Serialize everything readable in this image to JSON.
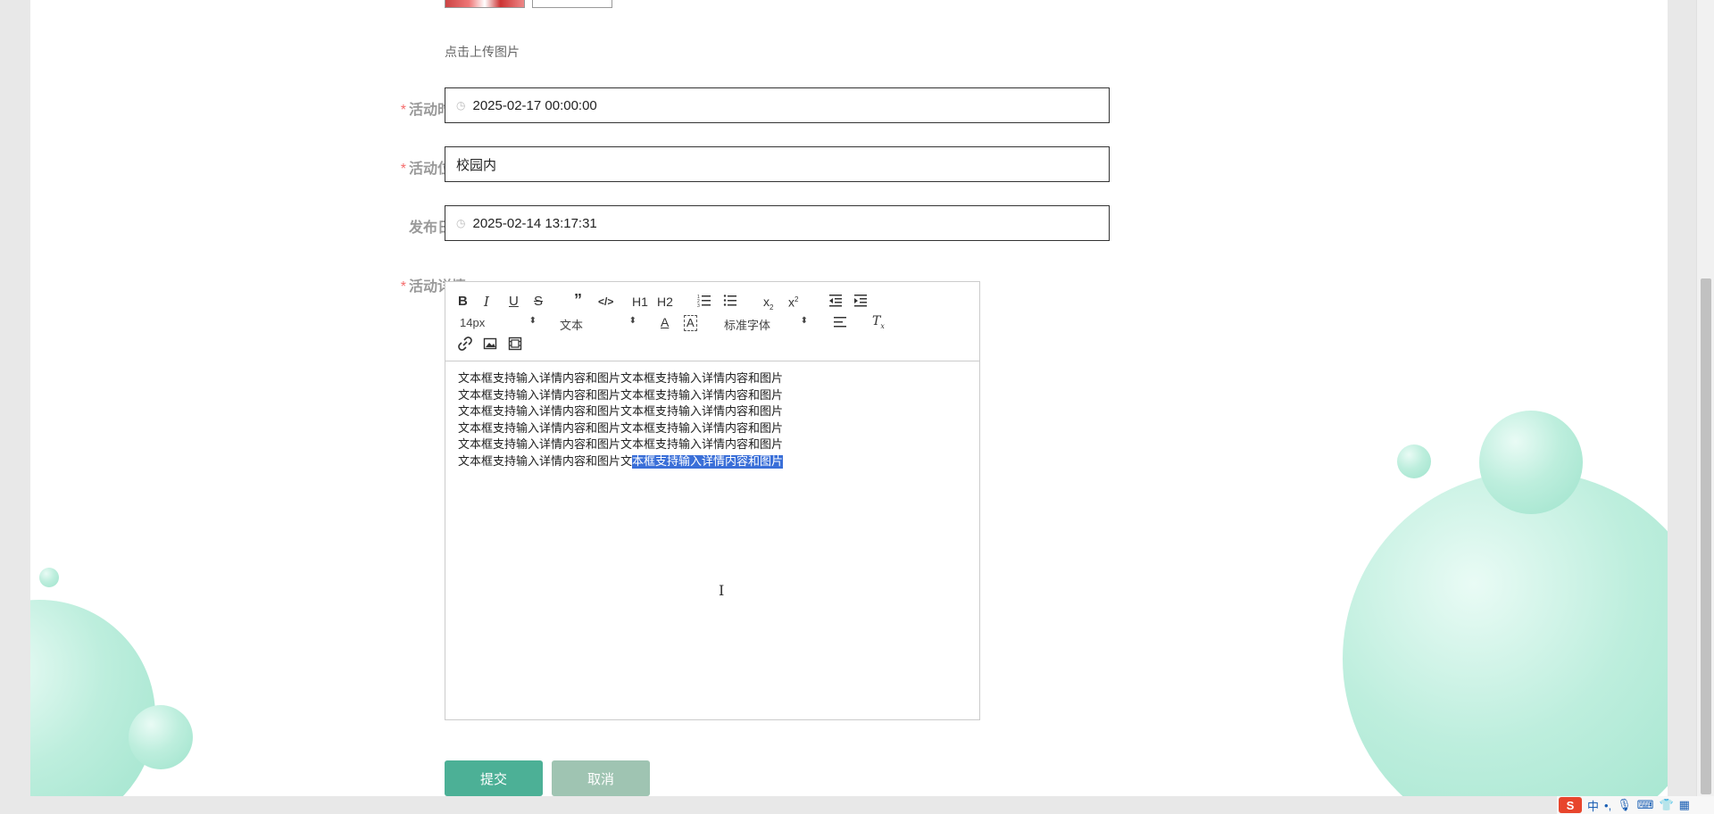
{
  "upload": {
    "hint": "点击上传图片"
  },
  "form": {
    "activity_time": {
      "label": "活动时间",
      "value": "2025-02-17 00:00:00",
      "required": true
    },
    "activity_location": {
      "label": "活动位置",
      "value": "校园内",
      "required": true
    },
    "publish_date": {
      "label": "发布日期",
      "value": "2025-02-14 13:17:31",
      "required": false
    },
    "activity_detail": {
      "label": "活动详情",
      "required": true
    },
    "required_mark": "*"
  },
  "editor": {
    "font_size": "14px",
    "block_type": "文本",
    "font_family": "标准字体",
    "toolbar_text": {
      "h1": "H1",
      "h2": "H2"
    },
    "content_lines": [
      "文本框支持输入详情内容和图片文本框支持输入详情内容和图片",
      "文本框支持输入详情内容和图片文本框支持输入详情内容和图片",
      "文本框支持输入详情内容和图片文本框支持输入详情内容和图片",
      "文本框支持输入详情内容和图片文本框支持输入详情内容和图片",
      "文本框支持输入详情内容和图片文本框支持输入详情内容和图片"
    ],
    "last_line_unselected": "文本框支持输入详情内容和图片文",
    "last_line_selected": "本框支持输入详情内容和图片"
  },
  "buttons": {
    "submit": "提交",
    "cancel": "取消"
  },
  "ime": {
    "logo": "S",
    "mode": "中",
    "punct": "•,"
  },
  "colors": {
    "accent": "#4cb096",
    "cancel": "#9fc4b2",
    "required": "#f56c6c",
    "selection": "#3a6fd8"
  }
}
